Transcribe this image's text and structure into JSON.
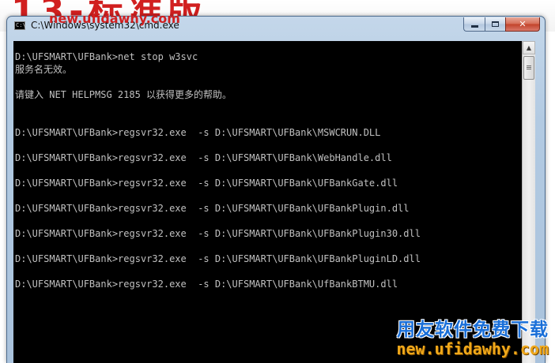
{
  "background": {
    "banner_text": "13-标准版"
  },
  "window": {
    "title": "C:\\Windows\\system32\\cmd.exe",
    "app_icon_glyph": "C:\\",
    "controls": {
      "close_glyph": "✕"
    }
  },
  "console": {
    "lines": [
      "D:\\UFSMART\\UFBank>net stop w3svc",
      "服务名无效。",
      "",
      "请键入 NET HELPMSG 2185 以获得更多的帮助。",
      "",
      "",
      "D:\\UFSMART\\UFBank>regsvr32.exe  -s D:\\UFSMART\\UFBank\\MSWCRUN.DLL",
      "",
      "D:\\UFSMART\\UFBank>regsvr32.exe  -s D:\\UFSMART\\UFBank\\WebHandle.dll",
      "",
      "D:\\UFSMART\\UFBank>regsvr32.exe  -s D:\\UFSMART\\UFBank\\UFBankGate.dll",
      "",
      "D:\\UFSMART\\UFBank>regsvr32.exe  -s D:\\UFSMART\\UFBank\\UFBankPlugin.dll",
      "",
      "D:\\UFSMART\\UFBank>regsvr32.exe  -s D:\\UFSMART\\UFBank\\UFBankPlugin30.dll",
      "",
      "D:\\UFSMART\\UFBank>regsvr32.exe  -s D:\\UFSMART\\UFBank\\UFBankPluginLD.dll",
      "",
      "D:\\UFSMART\\UFBank>regsvr32.exe  -s D:\\UFSMART\\UFBank\\UfBankBTMU.dll"
    ]
  },
  "scrollbar": {
    "up_arrow": "▲"
  },
  "watermarks": {
    "title_url": "new.ufidawhy.com",
    "cn_text": "用友软件免费下载",
    "bottom_url": "new.ufidawhy.com"
  },
  "colors": {
    "console_bg": "#000000",
    "console_text": "#c0c0c0",
    "watermark_red": "#d11f1f",
    "watermark_blue": "#1a6fd8",
    "watermark_orange": "#f0a81a"
  }
}
